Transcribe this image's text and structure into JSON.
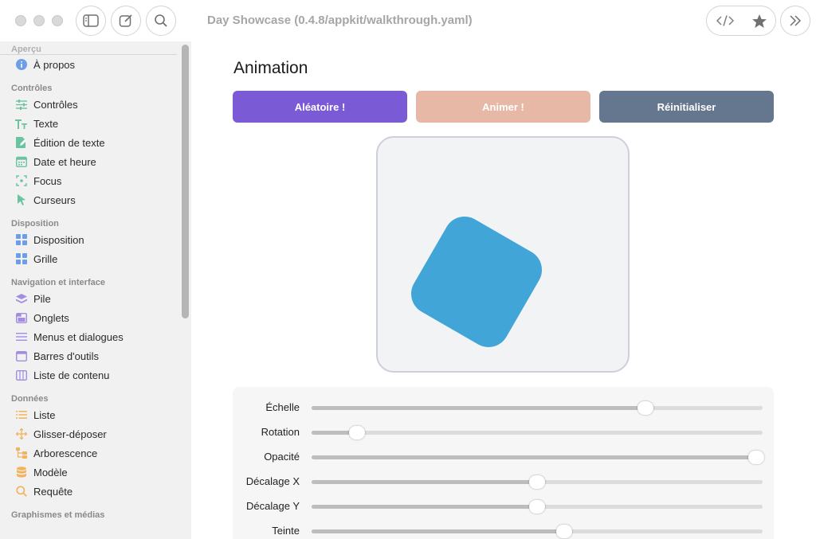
{
  "window": {
    "title": "Day Showcase (0.4.8/appkit/walkthrough.yaml)"
  },
  "sidebar": {
    "partial_top": "Aperçu",
    "about": "À propos",
    "sections": [
      {
        "title": "Contrôles",
        "items": [
          "Contrôles",
          "Texte",
          "Édition de texte",
          "Date et heure",
          "Focus",
          "Curseurs"
        ]
      },
      {
        "title": "Disposition",
        "items": [
          "Disposition",
          "Grille"
        ]
      },
      {
        "title": "Navigation et interface",
        "items": [
          "Pile",
          "Onglets",
          "Menus et dialogues",
          "Barres d'outils",
          "Liste de contenu"
        ]
      },
      {
        "title": "Données",
        "items": [
          "Liste",
          "Glisser-déposer",
          "Arborescence",
          "Modèle",
          "Requête"
        ]
      }
    ],
    "partial_bottom": "Graphismes et médias"
  },
  "main": {
    "title": "Animation",
    "buttons": {
      "random": "Aléatoire !",
      "animate": "Animer !",
      "reset": "Réinitialiser"
    },
    "sliders": [
      {
        "label": "Échelle",
        "value": 0.74
      },
      {
        "label": "Rotation",
        "value": 0.1
      },
      {
        "label": "Opacité",
        "value": 1.0
      },
      {
        "label": "Décalage X",
        "value": 0.5
      },
      {
        "label": "Décalage Y",
        "value": 0.5
      },
      {
        "label": "Teinte",
        "value": 0.56
      }
    ]
  },
  "colors": {
    "random_button": "#7b5ad6",
    "animate_button": "#e8b8a6",
    "reset_button": "#65768f",
    "shape": "#42a5d8"
  },
  "icons": {
    "about": "info-icon",
    "controls": [
      "sliders-icon",
      "text-icon",
      "edit-text-icon",
      "calendar-icon",
      "focus-icon",
      "cursor-icon"
    ],
    "layout": [
      "layout-grid-icon",
      "grid-icon"
    ],
    "navigation": [
      "stack-icon",
      "tabs-icon",
      "menu-icon",
      "toolbar-icon",
      "content-list-icon"
    ],
    "data": [
      "list-icon",
      "drag-drop-icon",
      "tree-icon",
      "model-icon",
      "query-icon"
    ]
  }
}
